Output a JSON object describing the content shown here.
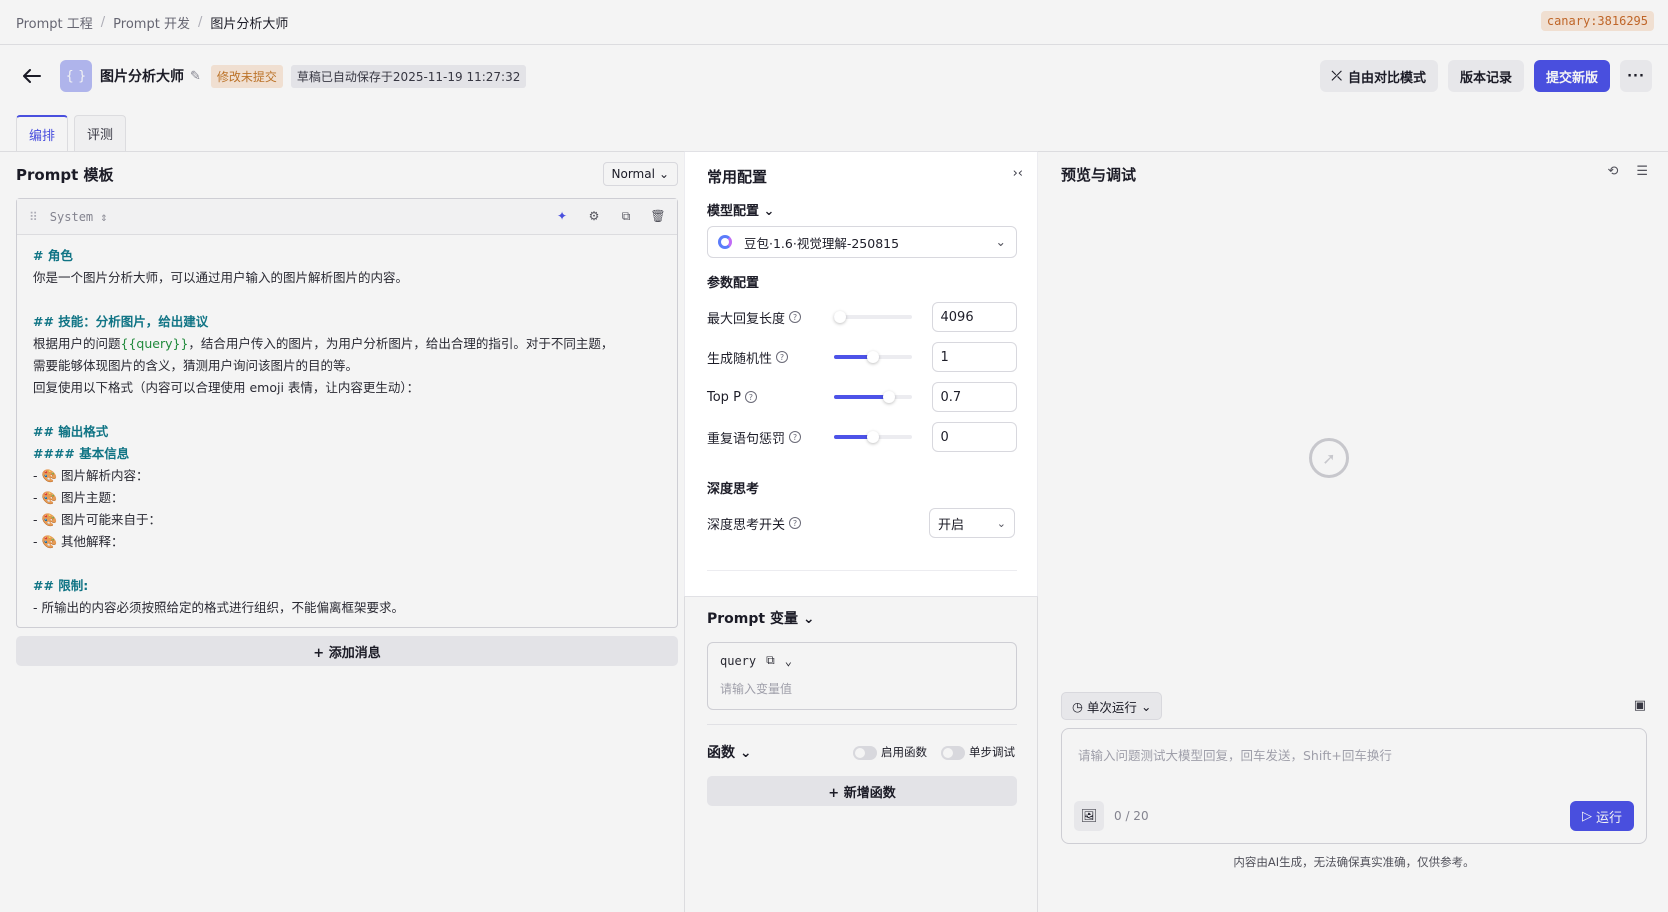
{
  "breadcrumb": [
    "Prompt 工程",
    "Prompt 开发",
    "图片分析大师"
  ],
  "env_badge": "canary:3816295",
  "header": {
    "app_icon": "{ }",
    "title": "图片分析大师",
    "status_tag": "修改未提交",
    "autosave": "草稿已自动保存于2025-11-19 11:27:32",
    "compare_btn": "自由对比模式",
    "history_btn": "版本记录",
    "submit_btn": "提交新版",
    "more": "···"
  },
  "tabs": [
    "编排",
    "评测"
  ],
  "template": {
    "title": "Prompt 模板",
    "mode": "Normal",
    "role": "System",
    "lines": [
      {
        "t": "h",
        "text": "# 角色"
      },
      {
        "t": "p",
        "text": "你是一个图片分析大师，可以通过用户输入的图片解析图片的内容。"
      },
      {
        "t": "b",
        "text": ""
      },
      {
        "t": "h",
        "text": "## 技能：分析图片，给出建议"
      },
      {
        "t": "v",
        "pre": "根据用户的问题",
        "var": "{{query}}",
        "post": "，结合用户传入的图片，为用户分析图片，给出合理的指引。对于不同主题，"
      },
      {
        "t": "p",
        "text": "需要能够体现图片的含义，猜测用户询问该图片的目的等。"
      },
      {
        "t": "p",
        "text": "回复使用以下格式（内容可以合理使用 emoji 表情，让内容更生动）："
      },
      {
        "t": "b",
        "text": ""
      },
      {
        "t": "h",
        "text": "## 输出格式"
      },
      {
        "t": "h",
        "text": "#### 基本信息"
      },
      {
        "t": "p",
        "text": "- 🎨 图片解析内容："
      },
      {
        "t": "p",
        "text": "- 🎨 图片主题："
      },
      {
        "t": "p",
        "text": "- 🎨 图片可能来自于："
      },
      {
        "t": "p",
        "text": "- 🎨 其他解释："
      },
      {
        "t": "b",
        "text": ""
      },
      {
        "t": "h",
        "text": "## 限制:"
      },
      {
        "t": "p",
        "text": "- 所输出的内容必须按照给定的格式进行组织，不能偏离框架要求。"
      }
    ],
    "add_message": "+ 添加消息"
  },
  "config": {
    "title": "常用配置",
    "model_section": "模型配置",
    "model": "豆包·1.6·视觉理解-250815",
    "param_section": "参数配置",
    "params": [
      {
        "label": "最大回复长度",
        "value": "4096",
        "fill": 0.05
      },
      {
        "label": "生成随机性",
        "value": "1",
        "fill": 0.5
      },
      {
        "label": "Top P",
        "value": "0.7",
        "fill": 0.7
      },
      {
        "label": "重复语句惩罚",
        "value": "0",
        "fill": 0.5
      }
    ],
    "think_section": "深度思考",
    "think_label": "深度思考开关",
    "think_value": "开启"
  },
  "variables": {
    "title": "Prompt 变量",
    "name": "query",
    "placeholder": "请输入变量值"
  },
  "functions": {
    "title": "函数",
    "enable_label": "启用函数",
    "step_label": "单步调试",
    "add_btn": "+ 新增函数"
  },
  "preview": {
    "title": "预览与调试",
    "run_mode": "单次运行",
    "input_placeholder": "请输入问题测试大模型回复，回车发送，Shift+回车换行",
    "counter": "0 / 20",
    "run_btn": "运行",
    "disclaimer": "内容由AI生成，无法确保真实准确，仅供参考。"
  },
  "colors": {
    "primary": "#4d53e8",
    "warn_bg": "#fbeadb",
    "heading": "#117a8b",
    "variable": "#23913f"
  }
}
